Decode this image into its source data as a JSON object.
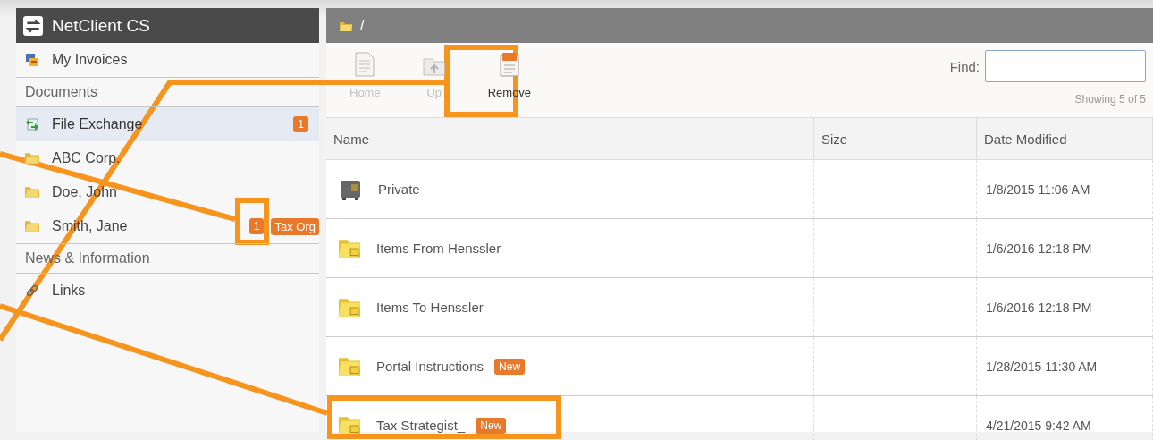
{
  "app": {
    "title": "NetClient CS"
  },
  "sidebar": {
    "items": [
      {
        "kind": "item",
        "label": "My Invoices",
        "selected": false
      },
      {
        "kind": "section",
        "label": "Documents"
      },
      {
        "kind": "item",
        "label": "File Exchange",
        "selected": true,
        "badge": "1"
      },
      {
        "kind": "item",
        "label": "ABC Corp.",
        "selected": false
      },
      {
        "kind": "item",
        "label": "Doe, John",
        "selected": false
      },
      {
        "kind": "item",
        "label": "Smith, Jane",
        "selected": false,
        "badge": "1",
        "tag": "Tax Org"
      },
      {
        "kind": "section",
        "label": "News & Information"
      },
      {
        "kind": "item",
        "label": "Links",
        "selected": false
      }
    ]
  },
  "path": "/",
  "toolbar": [
    {
      "label": "Home",
      "disabled": true
    },
    {
      "label": "Up",
      "disabled": true
    },
    {
      "label": "Remove",
      "disabled": false
    }
  ],
  "find": {
    "label": "Find:"
  },
  "showing": "Showing 5 of 5",
  "table": {
    "columns": [
      "Name",
      "Size",
      "Date Modified"
    ],
    "rows": [
      {
        "name": "Private",
        "date": "1/8/2015 11:06 AM"
      },
      {
        "name": "Items From Henssler",
        "date": "1/6/2016 12:18 PM"
      },
      {
        "name": "Items To Henssler",
        "date": "1/6/2016 12:18 PM"
      },
      {
        "name": "Portal Instructions",
        "date": "1/28/2015 11:30 AM",
        "badge": "New"
      },
      {
        "name": "Tax Strategist_",
        "date": "4/21/2015 9:42 AM",
        "badge": "New"
      }
    ]
  }
}
